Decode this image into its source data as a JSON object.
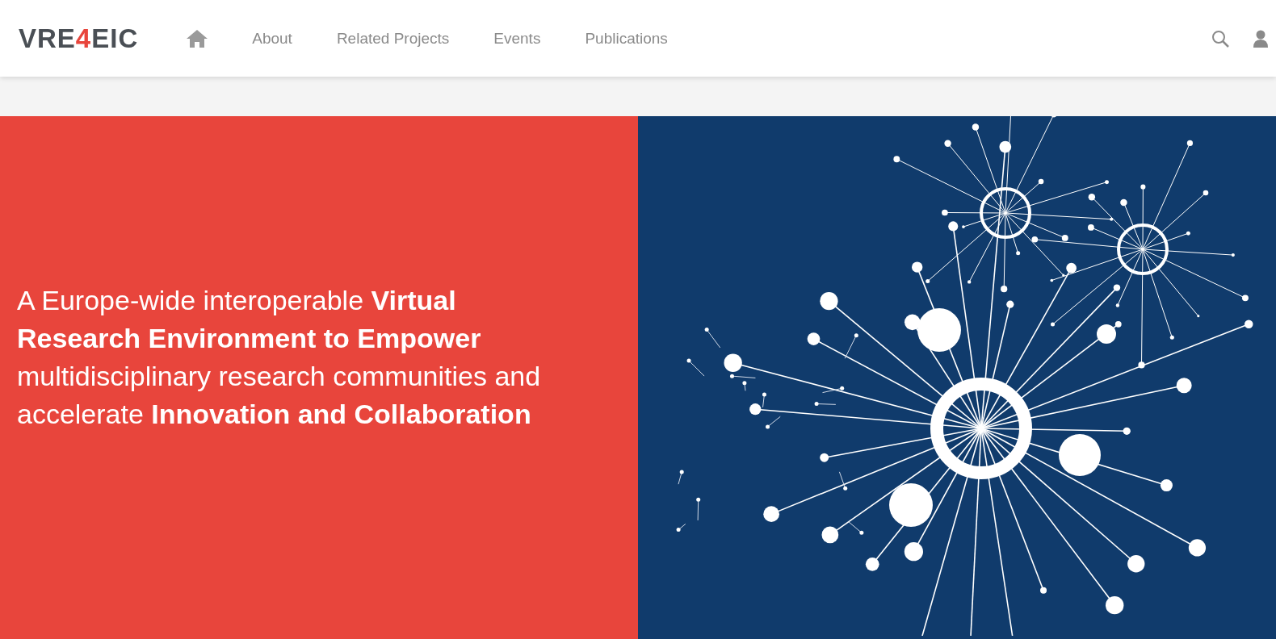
{
  "logo": {
    "prefix": "VRE",
    "accent": "4",
    "suffix": "EIC"
  },
  "nav": [
    {
      "label": "About"
    },
    {
      "label": "Related Projects"
    },
    {
      "label": "Events"
    },
    {
      "label": "Publications"
    }
  ],
  "hero": {
    "headline": "A Europe-wide interoperable **Virtual Research Environment to Empower** multidisciplinary research communities and accelerate **Innovation and Collaboration**",
    "illustration": {
      "kind": "network"
    }
  }
}
